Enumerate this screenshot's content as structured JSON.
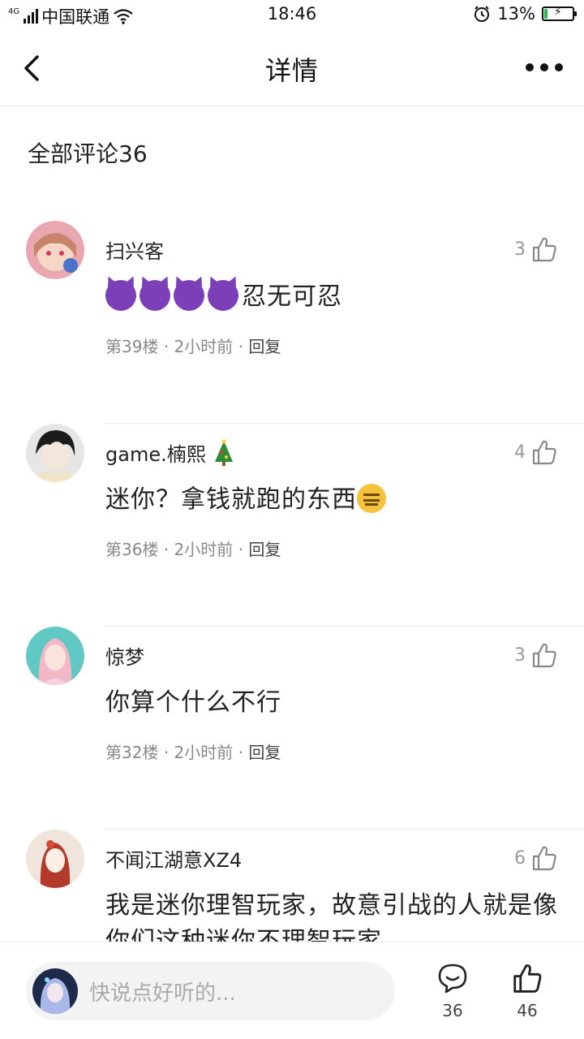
{
  "status_bar": {
    "network": "4G",
    "carrier": "中国联通",
    "time": "18:46",
    "battery": "13%",
    "battery_level": 0.13
  },
  "nav": {
    "title": "详情",
    "back_icon": "chevron-left-icon",
    "more_icon": "more-horizontal-icon"
  },
  "section_title": "全部评论36",
  "comments": [
    {
      "username": "扫兴客",
      "likes": "3",
      "content_text": "忍无可忍",
      "emoji": "smiling-imp x4",
      "floor": "第39楼",
      "time": "2小时前",
      "reply": "回复"
    },
    {
      "username": "game.楠熙",
      "username_emoji": "christmas-tree",
      "likes": "4",
      "content_text": "迷你？拿钱就跑的东西",
      "emoji": "expressionless-face",
      "floor": "第36楼",
      "time": "2小时前",
      "reply": "回复"
    },
    {
      "username": "惊梦",
      "likes": "3",
      "content_text": "你算个什么不行",
      "floor": "第32楼",
      "time": "2小时前",
      "reply": "回复"
    },
    {
      "username": "不闻江湖意XZ4",
      "likes": "6",
      "content_text": "我是迷你理智玩家，故意引战的人就是像你们这种迷你不理智玩家"
    }
  ],
  "bottom_bar": {
    "placeholder": "快说点好听的...",
    "comment_count": "36",
    "like_count": "46"
  },
  "colors": {
    "battery_green": "#2db84d",
    "text_primary": "#222222",
    "text_secondary": "#888888",
    "like_gray": "#999999",
    "divider": "#ececec"
  }
}
